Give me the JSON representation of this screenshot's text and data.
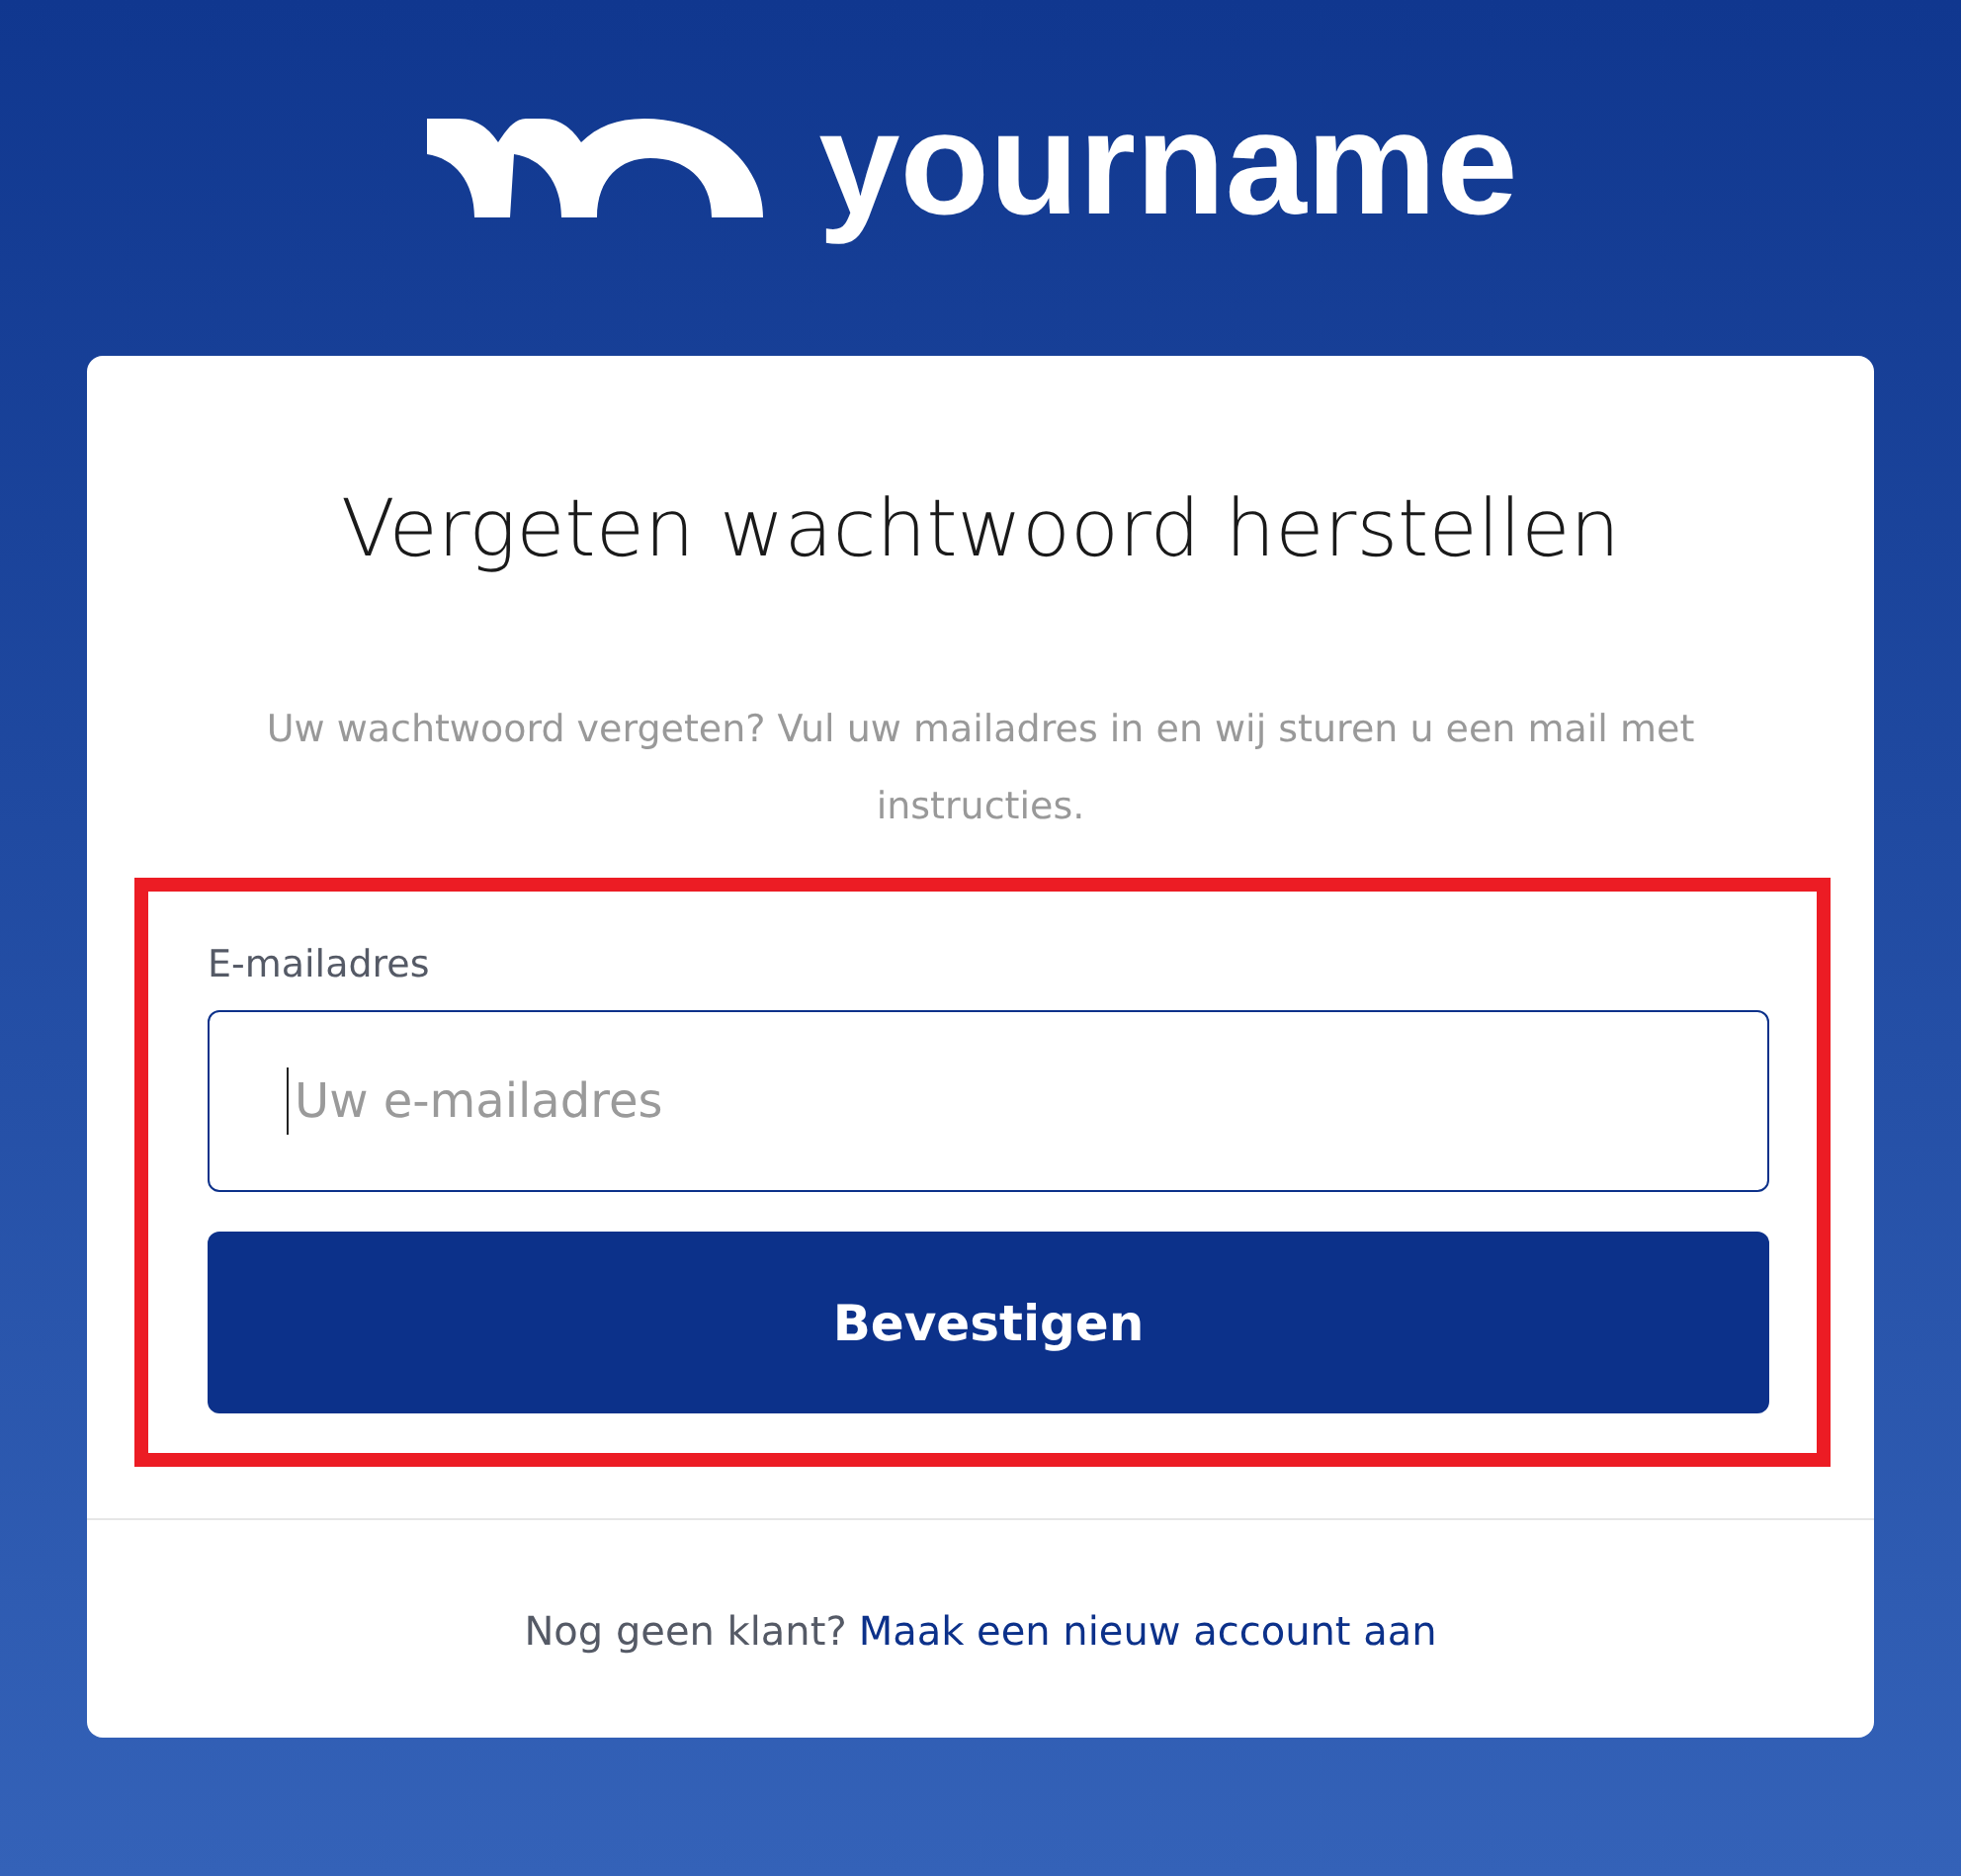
{
  "header": {
    "logo_text": "yourname"
  },
  "card": {
    "title": "Vergeten wachtwoord herstellen",
    "description": "Uw wachtwoord vergeten? Vul uw mailadres in en wij sturen u een mail met instructies.",
    "form": {
      "highlighted": true,
      "email_label": "E-mailadres",
      "email_field": {
        "placeholder": "Uw e-mailadres",
        "focused": true
      },
      "submit_button": "Bevestigen"
    },
    "footer": {
      "text": "Nog geen klant?",
      "link": "Maak een nieuw account aan"
    }
  }
}
